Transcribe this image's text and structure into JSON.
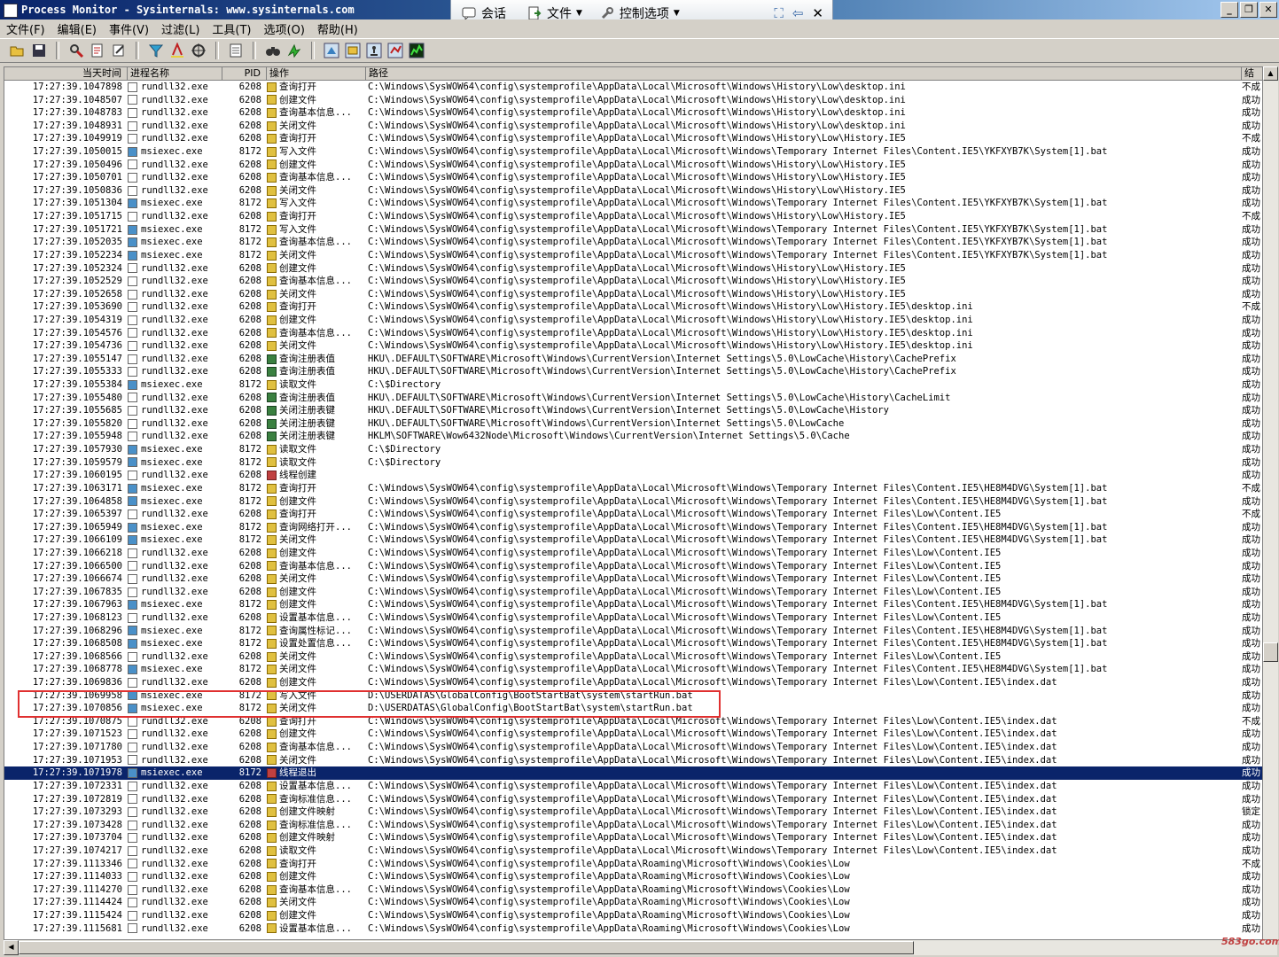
{
  "window": {
    "title": "Process Monitor - Sysinternals: www.sysinternals.com"
  },
  "floatbar": {
    "chat": "会话",
    "file": "文件",
    "control": "控制选项"
  },
  "menu": [
    "文件(F)",
    "编辑(E)",
    "事件(V)",
    "过滤(L)",
    "工具(T)",
    "选项(O)",
    "帮助(H)"
  ],
  "columns": {
    "time": "当天时间",
    "process": "进程名称",
    "pid": "PID",
    "operation": "操作",
    "path": "路径",
    "result": "结"
  },
  "rows": [
    [
      "17:27:39.1047898",
      "rundll32.exe",
      "6208",
      "查询打开",
      "C:\\Windows\\SysWOW64\\config\\systemprofile\\AppData\\Local\\Microsoft\\Windows\\History\\Low\\desktop.ini",
      "不成"
    ],
    [
      "17:27:39.1048507",
      "rundll32.exe",
      "6208",
      "创建文件",
      "C:\\Windows\\SysWOW64\\config\\systemprofile\\AppData\\Local\\Microsoft\\Windows\\History\\Low\\desktop.ini",
      "成功"
    ],
    [
      "17:27:39.1048783",
      "rundll32.exe",
      "6208",
      "查询基本信息...",
      "C:\\Windows\\SysWOW64\\config\\systemprofile\\AppData\\Local\\Microsoft\\Windows\\History\\Low\\desktop.ini",
      "成功"
    ],
    [
      "17:27:39.1048931",
      "rundll32.exe",
      "6208",
      "关闭文件",
      "C:\\Windows\\SysWOW64\\config\\systemprofile\\AppData\\Local\\Microsoft\\Windows\\History\\Low\\desktop.ini",
      "成功"
    ],
    [
      "17:27:39.1049919",
      "rundll32.exe",
      "6208",
      "查询打开",
      "C:\\Windows\\SysWOW64\\config\\systemprofile\\AppData\\Local\\Microsoft\\Windows\\History\\Low\\History.IE5",
      "不成"
    ],
    [
      "17:27:39.1050015",
      "msiexec.exe",
      "8172",
      "写入文件",
      "C:\\Windows\\SysWOW64\\config\\systemprofile\\AppData\\Local\\Microsoft\\Windows\\Temporary Internet Files\\Content.IE5\\YKFXYB7K\\System[1].bat",
      "成功"
    ],
    [
      "17:27:39.1050496",
      "rundll32.exe",
      "6208",
      "创建文件",
      "C:\\Windows\\SysWOW64\\config\\systemprofile\\AppData\\Local\\Microsoft\\Windows\\History\\Low\\History.IE5",
      "成功"
    ],
    [
      "17:27:39.1050701",
      "rundll32.exe",
      "6208",
      "查询基本信息...",
      "C:\\Windows\\SysWOW64\\config\\systemprofile\\AppData\\Local\\Microsoft\\Windows\\History\\Low\\History.IE5",
      "成功"
    ],
    [
      "17:27:39.1050836",
      "rundll32.exe",
      "6208",
      "关闭文件",
      "C:\\Windows\\SysWOW64\\config\\systemprofile\\AppData\\Local\\Microsoft\\Windows\\History\\Low\\History.IE5",
      "成功"
    ],
    [
      "17:27:39.1051304",
      "msiexec.exe",
      "8172",
      "写入文件",
      "C:\\Windows\\SysWOW64\\config\\systemprofile\\AppData\\Local\\Microsoft\\Windows\\Temporary Internet Files\\Content.IE5\\YKFXYB7K\\System[1].bat",
      "成功"
    ],
    [
      "17:27:39.1051715",
      "rundll32.exe",
      "6208",
      "查询打开",
      "C:\\Windows\\SysWOW64\\config\\systemprofile\\AppData\\Local\\Microsoft\\Windows\\History\\Low\\History.IE5",
      "不成"
    ],
    [
      "17:27:39.1051721",
      "msiexec.exe",
      "8172",
      "写入文件",
      "C:\\Windows\\SysWOW64\\config\\systemprofile\\AppData\\Local\\Microsoft\\Windows\\Temporary Internet Files\\Content.IE5\\YKFXYB7K\\System[1].bat",
      "成功"
    ],
    [
      "17:27:39.1052035",
      "msiexec.exe",
      "8172",
      "查询基本信息...",
      "C:\\Windows\\SysWOW64\\config\\systemprofile\\AppData\\Local\\Microsoft\\Windows\\Temporary Internet Files\\Content.IE5\\YKFXYB7K\\System[1].bat",
      "成功"
    ],
    [
      "17:27:39.1052234",
      "msiexec.exe",
      "8172",
      "关闭文件",
      "C:\\Windows\\SysWOW64\\config\\systemprofile\\AppData\\Local\\Microsoft\\Windows\\Temporary Internet Files\\Content.IE5\\YKFXYB7K\\System[1].bat",
      "成功"
    ],
    [
      "17:27:39.1052324",
      "rundll32.exe",
      "6208",
      "创建文件",
      "C:\\Windows\\SysWOW64\\config\\systemprofile\\AppData\\Local\\Microsoft\\Windows\\History\\Low\\History.IE5",
      "成功"
    ],
    [
      "17:27:39.1052529",
      "rundll32.exe",
      "6208",
      "查询基本信息...",
      "C:\\Windows\\SysWOW64\\config\\systemprofile\\AppData\\Local\\Microsoft\\Windows\\History\\Low\\History.IE5",
      "成功"
    ],
    [
      "17:27:39.1052658",
      "rundll32.exe",
      "6208",
      "关闭文件",
      "C:\\Windows\\SysWOW64\\config\\systemprofile\\AppData\\Local\\Microsoft\\Windows\\History\\Low\\History.IE5",
      "成功"
    ],
    [
      "17:27:39.1053690",
      "rundll32.exe",
      "6208",
      "查询打开",
      "C:\\Windows\\SysWOW64\\config\\systemprofile\\AppData\\Local\\Microsoft\\Windows\\History\\Low\\History.IE5\\desktop.ini",
      "不成"
    ],
    [
      "17:27:39.1054319",
      "rundll32.exe",
      "6208",
      "创建文件",
      "C:\\Windows\\SysWOW64\\config\\systemprofile\\AppData\\Local\\Microsoft\\Windows\\History\\Low\\History.IE5\\desktop.ini",
      "成功"
    ],
    [
      "17:27:39.1054576",
      "rundll32.exe",
      "6208",
      "查询基本信息...",
      "C:\\Windows\\SysWOW64\\config\\systemprofile\\AppData\\Local\\Microsoft\\Windows\\History\\Low\\History.IE5\\desktop.ini",
      "成功"
    ],
    [
      "17:27:39.1054736",
      "rundll32.exe",
      "6208",
      "关闭文件",
      "C:\\Windows\\SysWOW64\\config\\systemprofile\\AppData\\Local\\Microsoft\\Windows\\History\\Low\\History.IE5\\desktop.ini",
      "成功"
    ],
    [
      "17:27:39.1055147",
      "rundll32.exe",
      "6208",
      "查询注册表值",
      "HKU\\.DEFAULT\\SOFTWARE\\Microsoft\\Windows\\CurrentVersion\\Internet Settings\\5.0\\LowCache\\History\\CachePrefix",
      "成功"
    ],
    [
      "17:27:39.1055333",
      "rundll32.exe",
      "6208",
      "查询注册表值",
      "HKU\\.DEFAULT\\SOFTWARE\\Microsoft\\Windows\\CurrentVersion\\Internet Settings\\5.0\\LowCache\\History\\CachePrefix",
      "成功"
    ],
    [
      "17:27:39.1055384",
      "msiexec.exe",
      "8172",
      "读取文件",
      "C:\\$Directory",
      "成功"
    ],
    [
      "17:27:39.1055480",
      "rundll32.exe",
      "6208",
      "查询注册表值",
      "HKU\\.DEFAULT\\SOFTWARE\\Microsoft\\Windows\\CurrentVersion\\Internet Settings\\5.0\\LowCache\\History\\CacheLimit",
      "成功"
    ],
    [
      "17:27:39.1055685",
      "rundll32.exe",
      "6208",
      "关闭注册表键",
      "HKU\\.DEFAULT\\SOFTWARE\\Microsoft\\Windows\\CurrentVersion\\Internet Settings\\5.0\\LowCache\\History",
      "成功"
    ],
    [
      "17:27:39.1055820",
      "rundll32.exe",
      "6208",
      "关闭注册表键",
      "HKU\\.DEFAULT\\SOFTWARE\\Microsoft\\Windows\\CurrentVersion\\Internet Settings\\5.0\\LowCache",
      "成功"
    ],
    [
      "17:27:39.1055948",
      "rundll32.exe",
      "6208",
      "关闭注册表键",
      "HKLM\\SOFTWARE\\Wow6432Node\\Microsoft\\Windows\\CurrentVersion\\Internet Settings\\5.0\\Cache",
      "成功"
    ],
    [
      "17:27:39.1057930",
      "msiexec.exe",
      "8172",
      "读取文件",
      "C:\\$Directory",
      "成功"
    ],
    [
      "17:27:39.1059579",
      "msiexec.exe",
      "8172",
      "读取文件",
      "C:\\$Directory",
      "成功"
    ],
    [
      "17:27:39.1060195",
      "rundll32.exe",
      "6208",
      "线程创建",
      "",
      "成功"
    ],
    [
      "17:27:39.1063171",
      "msiexec.exe",
      "8172",
      "查询打开",
      "C:\\Windows\\SysWOW64\\config\\systemprofile\\AppData\\Local\\Microsoft\\Windows\\Temporary Internet Files\\Content.IE5\\HE8M4DVG\\System[1].bat",
      "不成"
    ],
    [
      "17:27:39.1064858",
      "msiexec.exe",
      "8172",
      "创建文件",
      "C:\\Windows\\SysWOW64\\config\\systemprofile\\AppData\\Local\\Microsoft\\Windows\\Temporary Internet Files\\Content.IE5\\HE8M4DVG\\System[1].bat",
      "成功"
    ],
    [
      "17:27:39.1065397",
      "rundll32.exe",
      "6208",
      "查询打开",
      "C:\\Windows\\SysWOW64\\config\\systemprofile\\AppData\\Local\\Microsoft\\Windows\\Temporary Internet Files\\Low\\Content.IE5",
      "不成"
    ],
    [
      "17:27:39.1065949",
      "msiexec.exe",
      "8172",
      "查询网络打开...",
      "C:\\Windows\\SysWOW64\\config\\systemprofile\\AppData\\Local\\Microsoft\\Windows\\Temporary Internet Files\\Content.IE5\\HE8M4DVG\\System[1].bat",
      "成功"
    ],
    [
      "17:27:39.1066109",
      "msiexec.exe",
      "8172",
      "关闭文件",
      "C:\\Windows\\SysWOW64\\config\\systemprofile\\AppData\\Local\\Microsoft\\Windows\\Temporary Internet Files\\Content.IE5\\HE8M4DVG\\System[1].bat",
      "成功"
    ],
    [
      "17:27:39.1066218",
      "rundll32.exe",
      "6208",
      "创建文件",
      "C:\\Windows\\SysWOW64\\config\\systemprofile\\AppData\\Local\\Microsoft\\Windows\\Temporary Internet Files\\Low\\Content.IE5",
      "成功"
    ],
    [
      "17:27:39.1066500",
      "rundll32.exe",
      "6208",
      "查询基本信息...",
      "C:\\Windows\\SysWOW64\\config\\systemprofile\\AppData\\Local\\Microsoft\\Windows\\Temporary Internet Files\\Low\\Content.IE5",
      "成功"
    ],
    [
      "17:27:39.1066674",
      "rundll32.exe",
      "6208",
      "关闭文件",
      "C:\\Windows\\SysWOW64\\config\\systemprofile\\AppData\\Local\\Microsoft\\Windows\\Temporary Internet Files\\Low\\Content.IE5",
      "成功"
    ],
    [
      "17:27:39.1067835",
      "rundll32.exe",
      "6208",
      "创建文件",
      "C:\\Windows\\SysWOW64\\config\\systemprofile\\AppData\\Local\\Microsoft\\Windows\\Temporary Internet Files\\Low\\Content.IE5",
      "成功"
    ],
    [
      "17:27:39.1067963",
      "msiexec.exe",
      "8172",
      "创建文件",
      "C:\\Windows\\SysWOW64\\config\\systemprofile\\AppData\\Local\\Microsoft\\Windows\\Temporary Internet Files\\Content.IE5\\HE8M4DVG\\System[1].bat",
      "成功"
    ],
    [
      "17:27:39.1068123",
      "rundll32.exe",
      "6208",
      "设置基本信息...",
      "C:\\Windows\\SysWOW64\\config\\systemprofile\\AppData\\Local\\Microsoft\\Windows\\Temporary Internet Files\\Low\\Content.IE5",
      "成功"
    ],
    [
      "17:27:39.1068296",
      "msiexec.exe",
      "8172",
      "查询属性标记...",
      "C:\\Windows\\SysWOW64\\config\\systemprofile\\AppData\\Local\\Microsoft\\Windows\\Temporary Internet Files\\Content.IE5\\HE8M4DVG\\System[1].bat",
      "成功"
    ],
    [
      "17:27:39.1068508",
      "msiexec.exe",
      "8172",
      "设置处置信息...",
      "C:\\Windows\\SysWOW64\\config\\systemprofile\\AppData\\Local\\Microsoft\\Windows\\Temporary Internet Files\\Content.IE5\\HE8M4DVG\\System[1].bat",
      "成功"
    ],
    [
      "17:27:39.1068566",
      "rundll32.exe",
      "6208",
      "关闭文件",
      "C:\\Windows\\SysWOW64\\config\\systemprofile\\AppData\\Local\\Microsoft\\Windows\\Temporary Internet Files\\Low\\Content.IE5",
      "成功"
    ],
    [
      "17:27:39.1068778",
      "msiexec.exe",
      "8172",
      "关闭文件",
      "C:\\Windows\\SysWOW64\\config\\systemprofile\\AppData\\Local\\Microsoft\\Windows\\Temporary Internet Files\\Content.IE5\\HE8M4DVG\\System[1].bat",
      "成功"
    ],
    [
      "17:27:39.1069836",
      "rundll32.exe",
      "6208",
      "创建文件",
      "C:\\Windows\\SysWOW64\\config\\systemprofile\\AppData\\Local\\Microsoft\\Windows\\Temporary Internet Files\\Low\\Content.IE5\\index.dat",
      "成功"
    ],
    [
      "17:27:39.1069958",
      "msiexec.exe",
      "8172",
      "写入文件",
      "D:\\USERDATAS\\GlobalConfig\\BootStartBat\\system\\startRun.bat",
      "成功"
    ],
    [
      "17:27:39.1070856",
      "msiexec.exe",
      "8172",
      "关闭文件",
      "D:\\USERDATAS\\GlobalConfig\\BootStartBat\\system\\startRun.bat",
      "成功"
    ],
    [
      "17:27:39.1070875",
      "rundll32.exe",
      "6208",
      "查询打开",
      "C:\\Windows\\SysWOW64\\config\\systemprofile\\AppData\\Local\\Microsoft\\Windows\\Temporary Internet Files\\Low\\Content.IE5\\index.dat",
      "不成"
    ],
    [
      "17:27:39.1071523",
      "rundll32.exe",
      "6208",
      "创建文件",
      "C:\\Windows\\SysWOW64\\config\\systemprofile\\AppData\\Local\\Microsoft\\Windows\\Temporary Internet Files\\Low\\Content.IE5\\index.dat",
      "成功"
    ],
    [
      "17:27:39.1071780",
      "rundll32.exe",
      "6208",
      "查询基本信息...",
      "C:\\Windows\\SysWOW64\\config\\systemprofile\\AppData\\Local\\Microsoft\\Windows\\Temporary Internet Files\\Low\\Content.IE5\\index.dat",
      "成功"
    ],
    [
      "17:27:39.1071953",
      "rundll32.exe",
      "6208",
      "关闭文件",
      "C:\\Windows\\SysWOW64\\config\\systemprofile\\AppData\\Local\\Microsoft\\Windows\\Temporary Internet Files\\Low\\Content.IE5\\index.dat",
      "成功"
    ],
    [
      "17:27:39.1071978",
      "msiexec.exe",
      "8172",
      "线程退出",
      "",
      "成功"
    ],
    [
      "17:27:39.1072331",
      "rundll32.exe",
      "6208",
      "设置基本信息...",
      "C:\\Windows\\SysWOW64\\config\\systemprofile\\AppData\\Local\\Microsoft\\Windows\\Temporary Internet Files\\Low\\Content.IE5\\index.dat",
      "成功"
    ],
    [
      "17:27:39.1072819",
      "rundll32.exe",
      "6208",
      "查询标准信息...",
      "C:\\Windows\\SysWOW64\\config\\systemprofile\\AppData\\Local\\Microsoft\\Windows\\Temporary Internet Files\\Low\\Content.IE5\\index.dat",
      "成功"
    ],
    [
      "17:27:39.1073293",
      "rundll32.exe",
      "6208",
      "创建文件映射",
      "C:\\Windows\\SysWOW64\\config\\systemprofile\\AppData\\Local\\Microsoft\\Windows\\Temporary Internet Files\\Low\\Content.IE5\\index.dat",
      "锁定"
    ],
    [
      "17:27:39.1073428",
      "rundll32.exe",
      "6208",
      "查询标准信息...",
      "C:\\Windows\\SysWOW64\\config\\systemprofile\\AppData\\Local\\Microsoft\\Windows\\Temporary Internet Files\\Low\\Content.IE5\\index.dat",
      "成功"
    ],
    [
      "17:27:39.1073704",
      "rundll32.exe",
      "6208",
      "创建文件映射",
      "C:\\Windows\\SysWOW64\\config\\systemprofile\\AppData\\Local\\Microsoft\\Windows\\Temporary Internet Files\\Low\\Content.IE5\\index.dat",
      "成功"
    ],
    [
      "17:27:39.1074217",
      "rundll32.exe",
      "6208",
      "读取文件",
      "C:\\Windows\\SysWOW64\\config\\systemprofile\\AppData\\Local\\Microsoft\\Windows\\Temporary Internet Files\\Low\\Content.IE5\\index.dat",
      "成功"
    ],
    [
      "17:27:39.1113346",
      "rundll32.exe",
      "6208",
      "查询打开",
      "C:\\Windows\\SysWOW64\\config\\systemprofile\\AppData\\Roaming\\Microsoft\\Windows\\Cookies\\Low",
      "不成"
    ],
    [
      "17:27:39.1114033",
      "rundll32.exe",
      "6208",
      "创建文件",
      "C:\\Windows\\SysWOW64\\config\\systemprofile\\AppData\\Roaming\\Microsoft\\Windows\\Cookies\\Low",
      "成功"
    ],
    [
      "17:27:39.1114270",
      "rundll32.exe",
      "6208",
      "查询基本信息...",
      "C:\\Windows\\SysWOW64\\config\\systemprofile\\AppData\\Roaming\\Microsoft\\Windows\\Cookies\\Low",
      "成功"
    ],
    [
      "17:27:39.1114424",
      "rundll32.exe",
      "6208",
      "关闭文件",
      "C:\\Windows\\SysWOW64\\config\\systemprofile\\AppData\\Roaming\\Microsoft\\Windows\\Cookies\\Low",
      "成功"
    ],
    [
      "17:27:39.1115424",
      "rundll32.exe",
      "6208",
      "创建文件",
      "C:\\Windows\\SysWOW64\\config\\systemprofile\\AppData\\Roaming\\Microsoft\\Windows\\Cookies\\Low",
      "成功"
    ],
    [
      "17:27:39.1115681",
      "rundll32.exe",
      "6208",
      "设置基本信息...",
      "C:\\Windows\\SysWOW64\\config\\systemprofile\\AppData\\Roaming\\Microsoft\\Windows\\Cookies\\Low",
      "成功"
    ]
  ],
  "selected_row": 53,
  "watermark": "583go.com",
  "colors": {
    "selection": "#0a246a",
    "highlight_box": "#e03030",
    "titlebar": "#0a246a"
  }
}
